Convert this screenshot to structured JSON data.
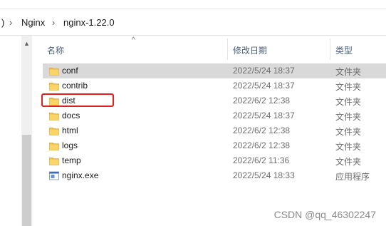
{
  "breadcrumb": {
    "items": [
      ")",
      "Nginx",
      "nginx-1.22.0"
    ]
  },
  "columns": {
    "name": "名称",
    "modified": "修改日期",
    "type": "类型"
  },
  "files": [
    {
      "name": "conf",
      "modified": "2022/5/24 18:37",
      "type": "文件夹",
      "icon": "folder-icon",
      "selected": true
    },
    {
      "name": "contrib",
      "modified": "2022/5/24 18:37",
      "type": "文件夹",
      "icon": "folder-icon",
      "selected": false
    },
    {
      "name": "dist",
      "modified": "2022/6/2 12:38",
      "type": "文件夹",
      "icon": "folder-icon",
      "selected": false,
      "highlighted": true
    },
    {
      "name": "docs",
      "modified": "2022/5/24 18:37",
      "type": "文件夹",
      "icon": "folder-icon",
      "selected": false
    },
    {
      "name": "html",
      "modified": "2022/6/2 12:38",
      "type": "文件夹",
      "icon": "folder-icon",
      "selected": false
    },
    {
      "name": "logs",
      "modified": "2022/6/2 12:38",
      "type": "文件夹",
      "icon": "folder-icon",
      "selected": false
    },
    {
      "name": "temp",
      "modified": "2022/6/2 11:36",
      "type": "文件夹",
      "icon": "folder-icon",
      "selected": false
    },
    {
      "name": "nginx.exe",
      "modified": "2022/5/24 18:33",
      "type": "应用程序",
      "icon": "exe-icon",
      "selected": false
    }
  ],
  "colors": {
    "selection": "#d9d9d9",
    "highlight_border": "#e0201b",
    "folder": "#f2c243",
    "header_text": "#4c607a"
  },
  "watermark": "CSDN @qq_46302247"
}
